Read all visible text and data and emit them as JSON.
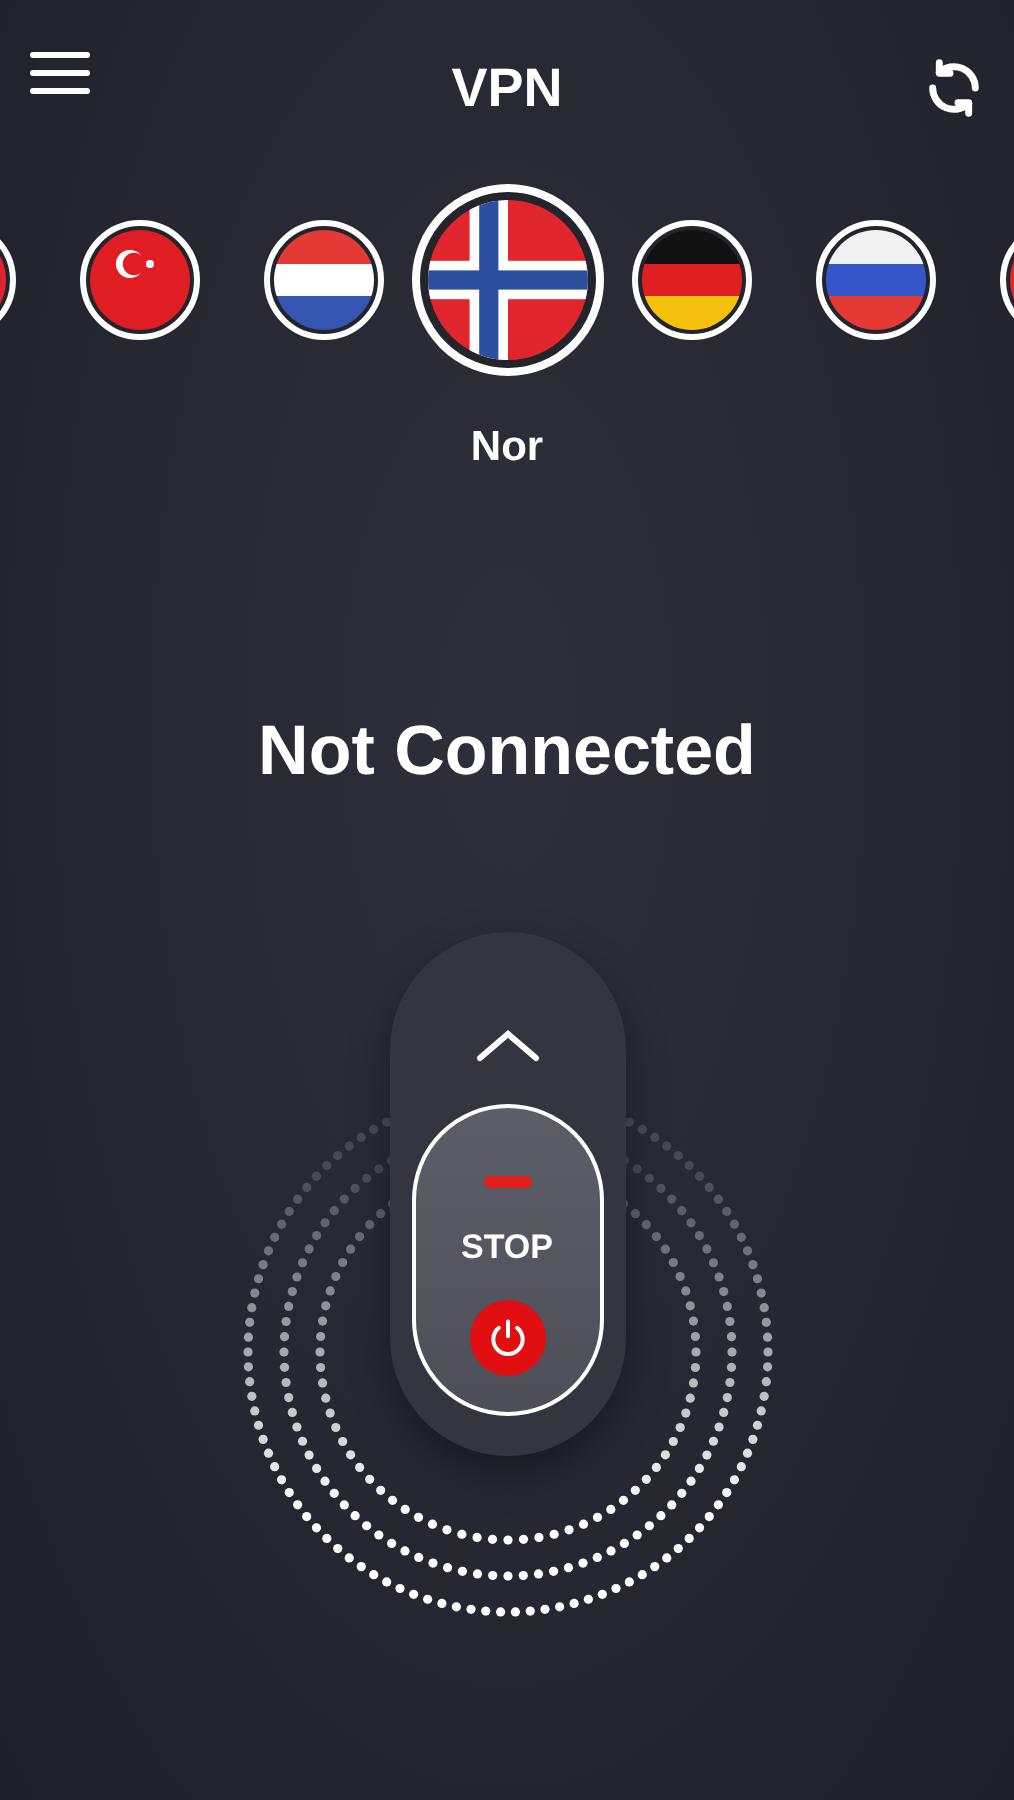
{
  "header": {
    "title": "VPN"
  },
  "flags": [
    {
      "kind": "red",
      "selected": false
    },
    {
      "kind": "tr",
      "selected": false
    },
    {
      "kind": "nl",
      "selected": false
    },
    {
      "kind": "no",
      "selected": true
    },
    {
      "kind": "de",
      "selected": false
    },
    {
      "kind": "ru",
      "selected": false
    },
    {
      "kind": "red",
      "selected": false
    }
  ],
  "country_label": "Nor",
  "status": "Not Connected",
  "control": {
    "label": "STOP"
  }
}
